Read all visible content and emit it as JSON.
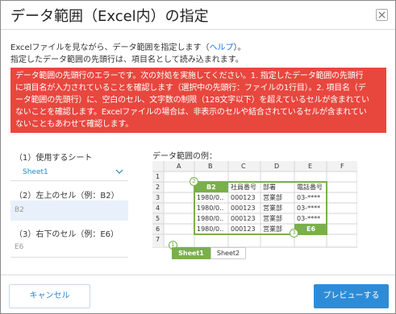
{
  "dialog": {
    "title": "データ範囲（Excel内）の指定",
    "close_icon": "close-icon"
  },
  "intro": {
    "line1_prefix": "Excelファイルを見ながら、データ範囲を指定します（",
    "help_link": "ヘルプ",
    "line1_suffix": "）。",
    "line2": "指定したデータ範囲の先頭行は、項目名として読み込まれます。"
  },
  "error": {
    "lines": [
      "データ範囲の先頭行のエラーです。次の対処を実施してください。1. 指定したデータ範囲の先頭行",
      "に項目名が入力されていることを確認します（選択中の先頭行：ファイルの1行目）。2. 項目名（デ",
      "ータ範囲の先頭行）に、空白のセル、文字数の制限（128文字以下）を超えているセルが含まれてい",
      "ないことを確認します。Excelファイルの場合は、非表示のセルや結合されているセルが含まれてい",
      "ないこともあわせて確認します。"
    ],
    "color": "#e8473e"
  },
  "form": {
    "sheet_label": "（1）使用するシート",
    "sheet_value": "Sheet1",
    "top_left_label": "（2）左上のセル（例：B2）",
    "top_left_value": "B2",
    "bottom_right_label": "（3）右下のセル（例：E6）",
    "bottom_right_placeholder": "E6"
  },
  "example": {
    "label": "データ範囲の例：",
    "columns": [
      "A",
      "B",
      "C",
      "D",
      "E",
      "F"
    ],
    "rows": [
      "1",
      "2",
      "3",
      "4",
      "5",
      "6",
      "7"
    ],
    "b2": "B2",
    "header_cells": [
      "社員番号",
      "部署",
      "電話番号"
    ],
    "data_rows": [
      [
        "1980/0..",
        "000123",
        "営業部",
        "03-****"
      ],
      [
        "1980/0..",
        "000123",
        "営業部",
        "03-****"
      ],
      [
        "1980/0..",
        "000123",
        "営業部",
        "03-****"
      ],
      [
        "1980/0..",
        "000123",
        "営業部"
      ]
    ],
    "e6": "E6",
    "badges": [
      "1",
      "2",
      "3"
    ],
    "tabs": [
      "Sheet1",
      "Sheet2"
    ],
    "accent": "#7ab04a"
  },
  "footer": {
    "cancel_label": "キャンセル",
    "preview_label": "プレビューする",
    "primary_color": "#2d8cd8"
  }
}
